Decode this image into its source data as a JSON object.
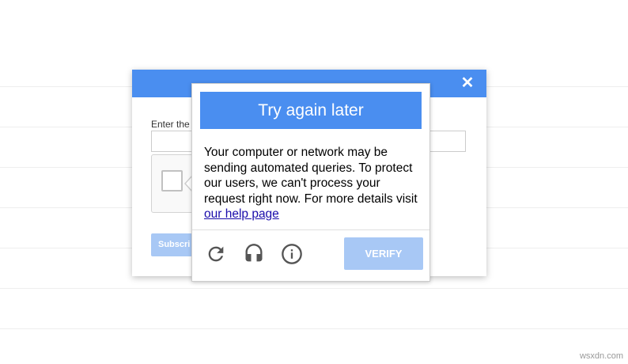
{
  "modal": {
    "close_label": "✕",
    "email_label": "Enter the",
    "subscribe_label": "Subscri"
  },
  "challenge": {
    "title": "Try again later",
    "message": "Your computer or network may be sending automated queries. To protect our users, we can't process your request right now. For more details visit ",
    "help_link_text": "our help page",
    "verify_label": "VERIFY",
    "icons": [
      "reload-icon",
      "headphones-icon",
      "info-icon"
    ]
  },
  "watermark": "wsxdn.com",
  "colors": {
    "accent_blue": "#4a8ef0",
    "disabled_button": "#a8c8f5",
    "link": "#1a0dab"
  }
}
